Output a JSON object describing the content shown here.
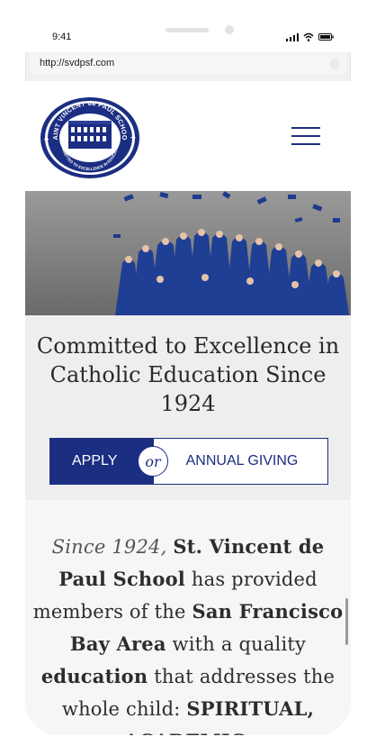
{
  "status_bar": {
    "time": "9:41"
  },
  "browser": {
    "url": "http://svdpsf.com"
  },
  "logo": {
    "arc_top": "SAINT VINCENT de PAUL SCHOOL",
    "arc_bottom": "COMMITTED TO EXCELLENCE IN EDUCATION"
  },
  "hero": {
    "tagline": "Committed to Excellence in Catholic Education Since 1924"
  },
  "cta": {
    "apply": "APPLY",
    "or": "or",
    "giving": "ANNUAL GIVING"
  },
  "intro": {
    "since": "Since 1924,",
    "school": "St. Vincent de Paul School",
    "text1": " has provided members of the ",
    "region": "San Francisco Bay Area",
    "text2": " with a quality ",
    "education": "education",
    "text3": " that addresses the whole child: ",
    "cut": "SPIRITUAL, ACADEMIC,"
  },
  "colors": {
    "brand_navy": "#1b2e82",
    "page_bg": "#f6f6f6"
  }
}
